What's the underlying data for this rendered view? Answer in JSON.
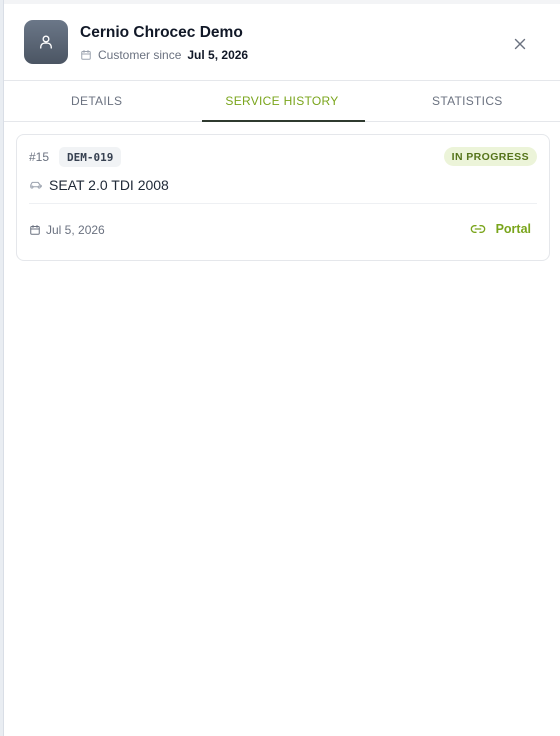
{
  "customer": {
    "name": "Cernio Chrocec Demo",
    "since_label": "Customer since",
    "since_date": "Jul 5, 2026"
  },
  "tabs": [
    {
      "label": "DETAILS",
      "active": false
    },
    {
      "label": "SERVICE HISTORY",
      "active": true
    },
    {
      "label": "STATISTICS",
      "active": false
    }
  ],
  "service_history": [
    {
      "number": "#15",
      "code": "DEM-019",
      "status": "IN PROGRESS",
      "vehicle": "SEAT 2.0 TDI 2008",
      "date": "Jul 5, 2026",
      "link_label": "Portal"
    }
  ],
  "icons": {
    "avatar": "user-icon",
    "calendar": "calendar-icon",
    "close": "close-icon",
    "vehicle": "car-icon",
    "link": "link-icon"
  },
  "colors": {
    "accent": "#7aa51c",
    "status_bg": "#ecf4d9",
    "status_text": "#55741a",
    "avatar_bg": "#556274"
  }
}
